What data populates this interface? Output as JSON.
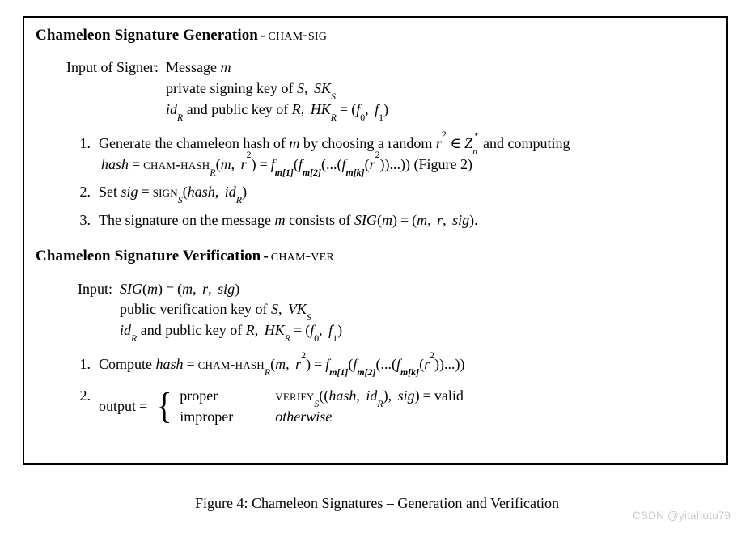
{
  "figure": {
    "caption": "Figure 4: Chameleon Signatures – Generation and Verification",
    "border_color": "#000000",
    "background": "#ffffff"
  },
  "watermark": {
    "text": "CSDN @yitahutu79",
    "color": "#c9c9c9"
  },
  "generation": {
    "heading_title": "Chameleon Signature Generation",
    "heading_dash": "-",
    "heading_name": "cham-sig",
    "input_label": "Input of Signer:",
    "input_lines": [
      {
        "text_plain": "Message m"
      },
      {
        "text_plain": "private signing key of S, SK_S"
      },
      {
        "text_plain": "id_R and public key of R, HK_R = (f_0, f_1)"
      }
    ],
    "steps": [
      {
        "number": "1.",
        "line1_plain": "Generate the chameleon hash of m by choosing a random r^2 ∈ Z*_n and computing",
        "line2_plain": "hash = cham-hash_R(m, r^2) = f_m[1](f_m[2](...(f_m[k](r^2))...)) (Figure 2)",
        "figure_ref": "(Figure 2)"
      },
      {
        "number": "2.",
        "line1_plain": "Set sig = sign_S(hash, id_R)"
      },
      {
        "number": "3.",
        "line1_plain": "The signature on the message m consists of SIG(m) = (m, r, sig)."
      }
    ]
  },
  "verification": {
    "heading_title": "Chameleon Signature Verification",
    "heading_dash": "-",
    "heading_name": "cham-ver",
    "input_label": "Input:",
    "input_lines": [
      {
        "text_plain": "SIG(m) = (m, r, sig)"
      },
      {
        "text_plain": "public verification key of S, VK_S"
      },
      {
        "text_plain": "id_R and public key of R, HK_R = (f_0, f_1)"
      }
    ],
    "steps": [
      {
        "number": "1.",
        "line1_plain": "Compute hash = cham-hash_R(m, r^2) = f_m[1](f_m[2](...(f_m[k](r^2))...))"
      },
      {
        "number": "2.",
        "label": "output",
        "equals": "=",
        "cases": [
          {
            "value": "proper",
            "condition_plain": "verify_S((hash, id_R), sig) = valid"
          },
          {
            "value": "improper",
            "condition_plain": "otherwise"
          }
        ]
      }
    ]
  }
}
